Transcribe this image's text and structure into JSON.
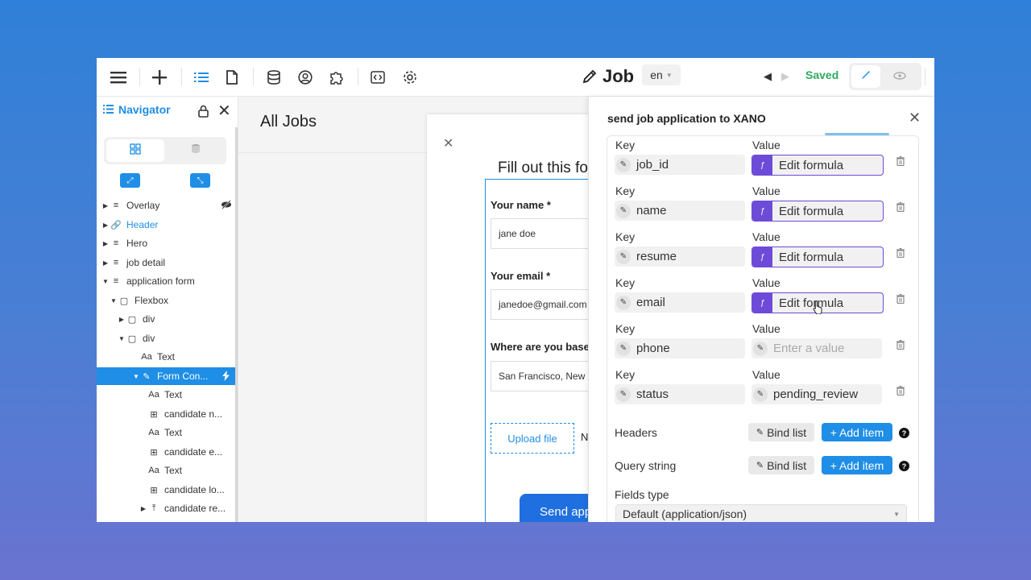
{
  "toolbar": {
    "page_title": "Job",
    "language": "en",
    "saved_label": "Saved",
    "icons": [
      "menu-icon",
      "plus-icon",
      "list-icon",
      "page-icon",
      "database-icon",
      "user-circle-icon",
      "puzzle-icon",
      "code-icon",
      "gear-icon"
    ]
  },
  "navigator": {
    "title": "Navigator",
    "tree": [
      {
        "label": "Overlay",
        "level": 0,
        "caret": "▶",
        "icon": "≡",
        "hidden": true
      },
      {
        "label": "Header",
        "level": 0,
        "caret": "▶",
        "icon": "🔗",
        "link": true
      },
      {
        "label": "Hero",
        "level": 0,
        "caret": "▶",
        "icon": "≡"
      },
      {
        "label": "job detail",
        "level": 0,
        "caret": "▶",
        "icon": "≡"
      },
      {
        "label": "application form",
        "level": 0,
        "caret": "▼",
        "icon": "≡"
      },
      {
        "label": "Flexbox",
        "level": 1,
        "caret": "▼",
        "icon": "▢"
      },
      {
        "label": "div",
        "level": 2,
        "caret": "▶",
        "icon": "▢"
      },
      {
        "label": "div",
        "level": 2,
        "caret": "▼",
        "icon": "▢"
      },
      {
        "label": "Text",
        "level": 3,
        "caret": "",
        "icon": "Aa"
      },
      {
        "label": "Form Con...",
        "level": 3,
        "caret": "▼",
        "icon": "✎",
        "selected": true
      },
      {
        "label": "Text",
        "level": 4,
        "caret": "",
        "icon": "Aa"
      },
      {
        "label": "candidate n...",
        "level": 4,
        "caret": "",
        "icon": "⊞"
      },
      {
        "label": "Text",
        "level": 4,
        "caret": "",
        "icon": "Aa"
      },
      {
        "label": "candidate e...",
        "level": 4,
        "caret": "",
        "icon": "⊞"
      },
      {
        "label": "Text",
        "level": 4,
        "caret": "",
        "icon": "Aa"
      },
      {
        "label": "candidate lo...",
        "level": 4,
        "caret": "",
        "icon": "⊞"
      },
      {
        "label": "candidate re...",
        "level": 4,
        "caret": "▶",
        "icon": "⤒"
      }
    ]
  },
  "canvas": {
    "page_heading": "All Jobs",
    "modal_title": "Fill out this fo",
    "name_label": "Your name *",
    "name_value": "jane doe",
    "email_label": "Your email *",
    "email_value": "janedoe@gmail.com",
    "location_label": "Where are you base",
    "location_value": "San Francisco, New",
    "upload_label": "Upload file",
    "upload_side": "N",
    "send_label": "Send app"
  },
  "panel": {
    "title": "send job application to XANO",
    "key_header": "Key",
    "value_header": "Value",
    "rows": [
      {
        "key": "job_id",
        "value": "Edit formula",
        "type": "formula"
      },
      {
        "key": "name",
        "value": "Edit formula",
        "type": "formula"
      },
      {
        "key": "resume",
        "value": "Edit formula",
        "type": "formula"
      },
      {
        "key": "email",
        "value": "Edit formula",
        "type": "formula"
      },
      {
        "key": "phone",
        "value": "Enter a value",
        "type": "placeholder"
      },
      {
        "key": "status",
        "value": "pending_review",
        "type": "plain"
      }
    ],
    "headers_label": "Headers",
    "query_label": "Query string",
    "bind_list": "Bind list",
    "add_item": "+ Add item",
    "help": "?",
    "fields_type_label": "Fields type",
    "fields_type_value": "Default (application/json)"
  }
}
